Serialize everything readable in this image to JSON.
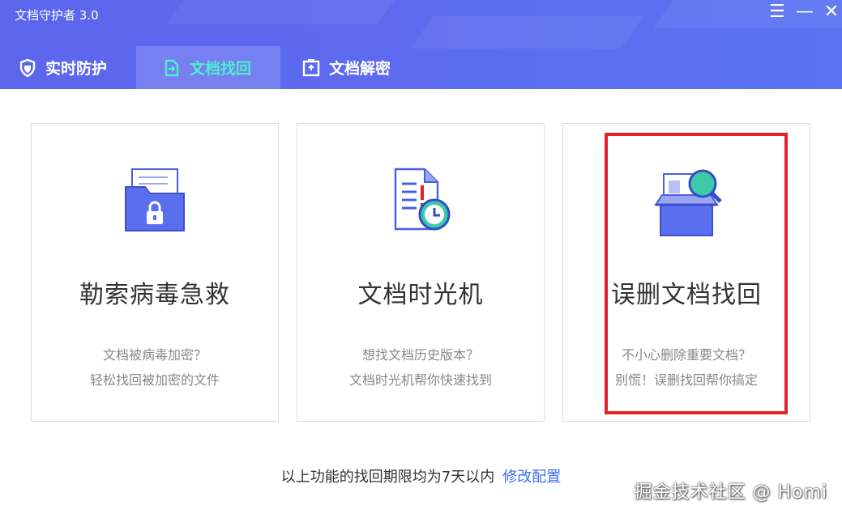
{
  "window": {
    "title": "文档守护者 3.0",
    "controls": [
      "menu-icon",
      "minimize-icon",
      "close-icon"
    ]
  },
  "tabs": [
    {
      "label": "实时防护",
      "icon": "shield-icon",
      "active": false
    },
    {
      "label": "文档找回",
      "icon": "document-recover-icon",
      "active": true
    },
    {
      "label": "文档解密",
      "icon": "document-decrypt-icon",
      "active": false
    }
  ],
  "cards": [
    {
      "title": "勒索病毒急救",
      "desc1": "文档被病毒加密？",
      "desc2": "轻松找回被加密的文件",
      "icon": "locked-folder-icon"
    },
    {
      "title": "文档时光机",
      "desc1": "想找文档历史版本？",
      "desc2": "文档时光机帮你快速找到",
      "icon": "document-clock-icon"
    },
    {
      "title": "误删文档找回",
      "desc1": "不小心删除重要文档？",
      "desc2": "别慌！误删找回帮你搞定",
      "icon": "box-search-icon"
    }
  ],
  "footer": {
    "text": "以上功能的找回期限均为7天以内",
    "link": "修改配置"
  },
  "watermark": "掘金技术社区 @ Homi",
  "colors": {
    "header": "#5b66ec",
    "active_tab_text": "#4cf0cf",
    "link": "#3a6cf2",
    "highlight": "#e3212a"
  }
}
